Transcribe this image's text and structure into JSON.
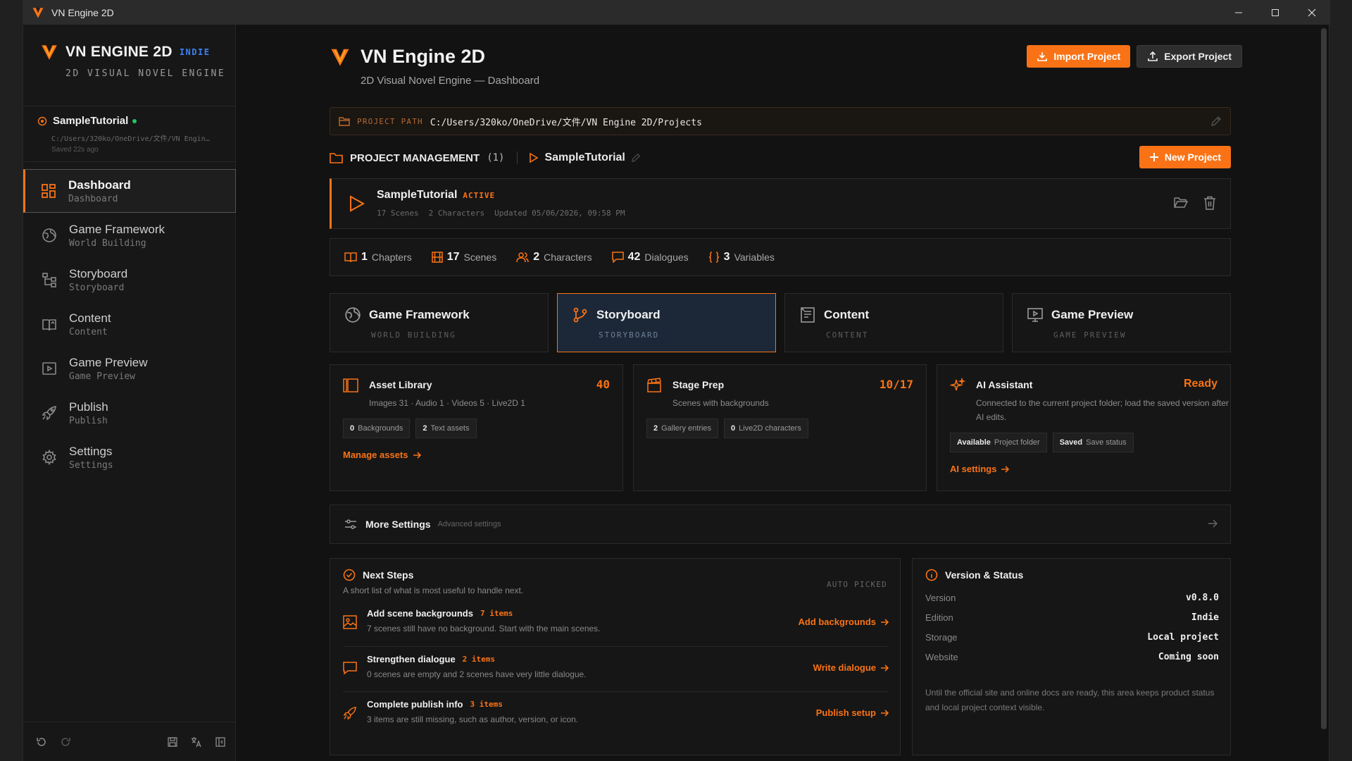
{
  "window": {
    "title": "VN Engine 2D"
  },
  "brand": {
    "title": "VN ENGINE 2D",
    "badge": "INDIE",
    "subtitle": "2D VISUAL NOVEL ENGINE"
  },
  "current_project": {
    "name": "SampleTutorial",
    "path": "C:/Users/320ko/OneDrive/文件/VN Engin…",
    "saved": "Saved 22s ago"
  },
  "nav": [
    {
      "label": "Dashboard",
      "sub": "Dashboard",
      "icon": "dashboard-icon"
    },
    {
      "label": "Game Framework",
      "sub": "World Building",
      "icon": "globe-icon"
    },
    {
      "label": "Storyboard",
      "sub": "Storyboard",
      "icon": "flowchart-icon"
    },
    {
      "label": "Content",
      "sub": "Content",
      "icon": "book-icon"
    },
    {
      "label": "Game Preview",
      "sub": "Game Preview",
      "icon": "play-screen-icon"
    },
    {
      "label": "Publish",
      "sub": "Publish",
      "icon": "rocket-icon"
    },
    {
      "label": "Settings",
      "sub": "Settings",
      "icon": "gear-icon"
    }
  ],
  "header": {
    "title": "VN Engine 2D",
    "subtitle": "2D Visual Novel Engine — Dashboard",
    "import_label": "Import Project",
    "export_label": "Export Project"
  },
  "project_path": {
    "label": "PROJECT PATH",
    "value": "C:/Users/320ko/OneDrive/文件/VN Engine 2D/Projects"
  },
  "project_management": {
    "title": "PROJECT MANAGEMENT",
    "count": "(1)",
    "current": "SampleTutorial",
    "new_label": "New Project"
  },
  "project_card": {
    "name": "SampleTutorial",
    "badge": "ACTIVE",
    "scenes": "17 Scenes",
    "characters": "2 Characters",
    "updated": "Updated 05/06/2026, 09:58 PM"
  },
  "stats": [
    {
      "value": "1",
      "label": "Chapters",
      "icon": "book-open-icon"
    },
    {
      "value": "17",
      "label": "Scenes",
      "icon": "film-icon"
    },
    {
      "value": "2",
      "label": "Characters",
      "icon": "users-icon"
    },
    {
      "value": "42",
      "label": "Dialogues",
      "icon": "chat-icon"
    },
    {
      "value": "3",
      "label": "Variables",
      "icon": "braces-icon"
    }
  ],
  "modules": [
    {
      "title": "Game Framework",
      "sub": "WORLD BUILDING"
    },
    {
      "title": "Storyboard",
      "sub": "STORYBOARD"
    },
    {
      "title": "Content",
      "sub": "CONTENT"
    },
    {
      "title": "Game Preview",
      "sub": "GAME PREVIEW"
    }
  ],
  "asset_library": {
    "title": "Asset Library",
    "value": "40",
    "desc": "Images 31 · Audio 1 · Videos 5 · Live2D 1",
    "chip1_num": "0",
    "chip1_label": "Backgrounds",
    "chip2_num": "2",
    "chip2_label": "Text assets",
    "link": "Manage assets"
  },
  "stage_prep": {
    "title": "Stage Prep",
    "value": "10/17",
    "desc": "Scenes with backgrounds",
    "chip1_num": "2",
    "chip1_label": "Gallery entries",
    "chip2_num": "0",
    "chip2_label": "Live2D characters"
  },
  "ai_assistant": {
    "title": "AI Assistant",
    "value": "Ready",
    "desc": "Connected to the current project folder; load the saved version after AI edits.",
    "chip1_num": "Available",
    "chip1_label": "Project folder",
    "chip2_num": "Saved",
    "chip2_label": "Save status",
    "link": "AI settings"
  },
  "more_settings": {
    "title": "More Settings",
    "sub": "Advanced settings"
  },
  "next_steps": {
    "title": "Next Steps",
    "desc": "A short list of what is most useful to handle next.",
    "auto": "AUTO PICKED",
    "items": [
      {
        "title": "Add scene backgrounds",
        "count": "7 items",
        "desc": "7 scenes still have no background. Start with the main scenes.",
        "link": "Add backgrounds"
      },
      {
        "title": "Strengthen dialogue",
        "count": "2 items",
        "desc": "0 scenes are empty and 2 scenes have very little dialogue.",
        "link": "Write dialogue"
      },
      {
        "title": "Complete publish info",
        "count": "3 items",
        "desc": "3 items are still missing, such as author, version, or icon.",
        "link": "Publish setup"
      }
    ]
  },
  "version_status": {
    "title": "Version & Status",
    "rows": [
      {
        "key": "Version",
        "value": "v0.8.0"
      },
      {
        "key": "Edition",
        "value": "Indie"
      },
      {
        "key": "Storage",
        "value": "Local project"
      },
      {
        "key": "Website",
        "value": "Coming soon"
      }
    ],
    "note": "Until the official site and online docs are ready, this area keeps product status and local project context visible."
  },
  "colors": {
    "accent": "#f97316",
    "background": "#121212",
    "panel": "#161616",
    "badge_blue": "#3c82f6",
    "online": "#22c55e"
  }
}
